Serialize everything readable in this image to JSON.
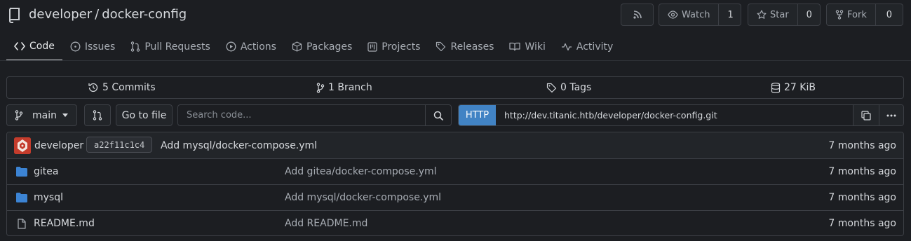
{
  "repo": {
    "owner": "developer",
    "name": "docker-config"
  },
  "header_buttons": {
    "rss_icon": "rss-icon",
    "watch": {
      "label": "Watch",
      "count": "1"
    },
    "star": {
      "label": "Star",
      "count": "0"
    },
    "fork": {
      "label": "Fork",
      "count": "0"
    }
  },
  "tabs": [
    {
      "label": "Code",
      "icon": "code-icon"
    },
    {
      "label": "Issues",
      "icon": "issue-icon"
    },
    {
      "label": "Pull Requests",
      "icon": "pull-request-icon"
    },
    {
      "label": "Actions",
      "icon": "play-icon"
    },
    {
      "label": "Packages",
      "icon": "package-icon"
    },
    {
      "label": "Projects",
      "icon": "project-icon"
    },
    {
      "label": "Releases",
      "icon": "tag-icon"
    },
    {
      "label": "Wiki",
      "icon": "book-icon"
    },
    {
      "label": "Activity",
      "icon": "pulse-icon"
    }
  ],
  "stats": {
    "commits": "5 Commits",
    "branches": "1 Branch",
    "tags": "0 Tags",
    "size": "27 KiB"
  },
  "toolbar": {
    "branch": "main",
    "goto_file": "Go to file",
    "search_placeholder": "Search code...",
    "clone_protocol": "HTTP",
    "clone_url": "http://dev.titanic.htb/developer/docker-config.git"
  },
  "latest_commit": {
    "author": "developer",
    "sha": "a22f11c1c4",
    "message": "Add mysql/docker-compose.yml",
    "age": "7 months ago"
  },
  "files": [
    {
      "name": "gitea",
      "type": "folder",
      "message": "Add gitea/docker-compose.yml",
      "age": "7 months ago"
    },
    {
      "name": "mysql",
      "type": "folder",
      "message": "Add mysql/docker-compose.yml",
      "age": "7 months ago"
    },
    {
      "name": "README.md",
      "type": "file",
      "message": "Add README.md",
      "age": "7 months ago"
    }
  ],
  "colors": {
    "background": "#1c1e22",
    "accent": "#4183c4",
    "folder": "#3c84d4",
    "avatar": "#c43c2c"
  }
}
